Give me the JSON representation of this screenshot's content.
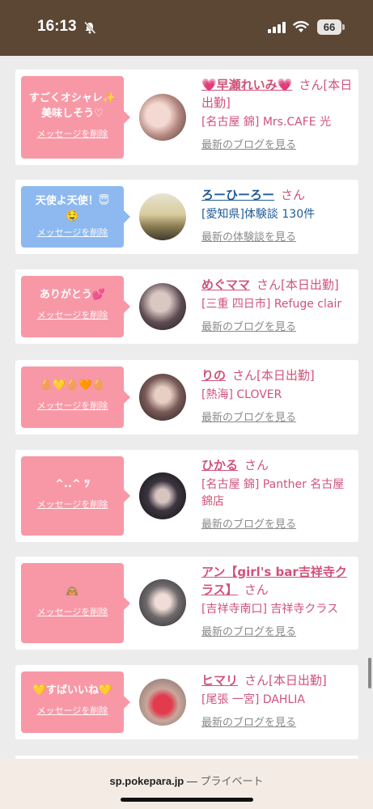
{
  "status_bar": {
    "time": "16:13",
    "battery": "66"
  },
  "cards": [
    {
      "bubble_text": "すごくオシャレ✨\n美味しそう♡",
      "bubble_color": "#f898a6",
      "delete_label": "メッセージを削除",
      "name": "💗早瀬れいみ💗",
      "suffix": "さん[本日出勤]",
      "shop": "[名古屋 錦] Mrs.CAFE 光",
      "link": "最新のブログを見る",
      "theme": "pink"
    },
    {
      "bubble_text": "天使よ天使！😇\n🤤",
      "bubble_color": "#8db9f0",
      "delete_label": "メッセージを削除",
      "name": "ろーひーろー",
      "suffix": "さん",
      "shop": "[愛知県]体験談 130件",
      "link": "最新の体験談を見る",
      "theme": "blue"
    },
    {
      "bubble_text": "ありがとう💕",
      "bubble_color": "#f898a6",
      "delete_label": "メッセージを削除",
      "name": "めぐママ",
      "suffix": "さん[本日出勤]",
      "shop": "[三重 四日市] Refuge clair",
      "link": "最新のブログを見る",
      "theme": "pink"
    },
    {
      "bubble_text": "🥚💛🥚🧡🥚",
      "bubble_color": "#f898a6",
      "delete_label": "メッセージを削除",
      "name": "りの",
      "suffix": "さん[本日出勤]",
      "shop": "[熱海] CLOVER",
      "link": "最新のブログを見る",
      "theme": "pink"
    },
    {
      "bubble_text": "^..^ ﾂ",
      "bubble_color": "#f898a6",
      "delete_label": "メッセージを削除",
      "name": "ひかる",
      "suffix": "さん",
      "shop": "[名古屋 錦] Panther 名古屋錦店",
      "link": "最新のブログを見る",
      "theme": "pink"
    },
    {
      "bubble_text": "🙈",
      "bubble_color": "#f898a6",
      "delete_label": "メッセージを削除",
      "name": "アン【girl's bar吉祥寺クラス】",
      "suffix": "さん",
      "shop": "[吉祥寺南口] 吉祥寺クラス",
      "link": "最新のブログを見る",
      "theme": "pink"
    },
    {
      "bubble_text": "💛すばいいね💛",
      "bubble_color": "#f898a6",
      "delete_label": "メッセージを削除",
      "name": "ヒマリ",
      "suffix": "さん[本日出勤]",
      "shop": "[尾張 一宮] DAHLIA",
      "link": "最新のブログを見る",
      "theme": "pink"
    }
  ],
  "browser": {
    "domain": "sp.pokepara.jp",
    "separator": " — ",
    "mode": "プライベート"
  }
}
